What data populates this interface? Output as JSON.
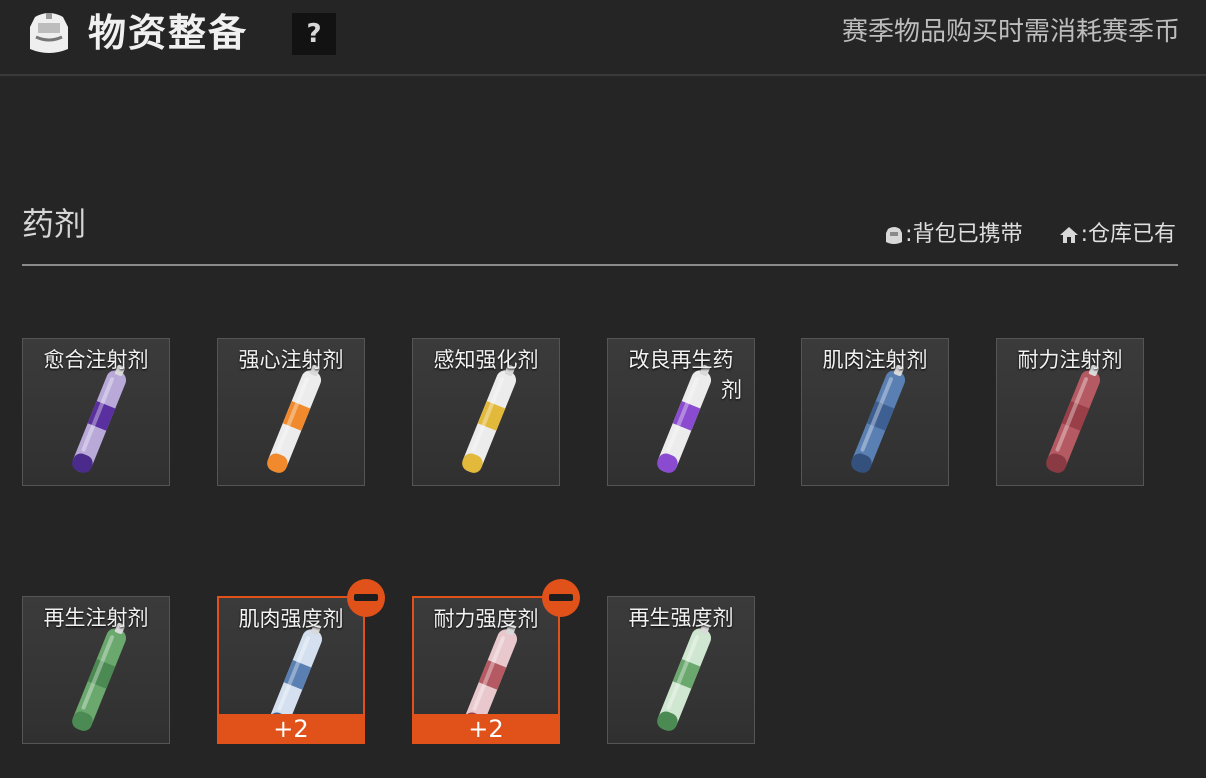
{
  "header": {
    "title": "物资整备",
    "help_label": "?",
    "note": "赛季物品购买时需消耗赛季币"
  },
  "section": {
    "title": "药剂",
    "legend": {
      "backpack": ":背包已携带",
      "warehouse": ":仓库已有"
    }
  },
  "items": [
    {
      "name": "愈合注射剂",
      "line2": "",
      "colors": {
        "body": "#b9a9d9",
        "band": "#5a2fa0",
        "tip": "#4a2a8a"
      },
      "selected": false
    },
    {
      "name": "强心注射剂",
      "line2": "",
      "colors": {
        "body": "#ececec",
        "band": "#f08a2c",
        "tip": "#f08a2c"
      },
      "selected": false
    },
    {
      "name": "感知强化剂",
      "line2": "",
      "colors": {
        "body": "#ececec",
        "band": "#e2b93a",
        "tip": "#e2b93a"
      },
      "selected": false
    },
    {
      "name": "改良再生药",
      "line2": "剂",
      "colors": {
        "body": "#ececec",
        "band": "#8a4bd0",
        "tip": "#8a4bd0"
      },
      "selected": false
    },
    {
      "name": "肌肉注射剂",
      "line2": "",
      "colors": {
        "body": "#5a7fb3",
        "band": "#3e5f92",
        "tip": "#34507c"
      },
      "selected": false
    },
    {
      "name": "耐力注射剂",
      "line2": "",
      "colors": {
        "body": "#b55a62",
        "band": "#9a3f48",
        "tip": "#8a3a42"
      },
      "selected": false
    },
    {
      "name": "再生注射剂",
      "line2": "",
      "colors": {
        "body": "#6aa86e",
        "band": "#4b8a52",
        "tip": "#4b8a52"
      },
      "selected": false
    },
    {
      "name": "肌肉强度剂",
      "line2": "",
      "colors": {
        "body": "#d4e0f0",
        "band": "#5a7fb3",
        "tip": "#3e5f92"
      },
      "selected": true,
      "quantity": "+2"
    },
    {
      "name": "耐力强度剂",
      "line2": "",
      "colors": {
        "body": "#e8c8cc",
        "band": "#b55a62",
        "tip": "#9a3f48"
      },
      "selected": true,
      "quantity": "+2"
    },
    {
      "name": "再生强度剂",
      "line2": "",
      "colors": {
        "body": "#cfe6d0",
        "band": "#6aa86e",
        "tip": "#4b8a52"
      },
      "selected": false
    }
  ],
  "accent_color": "#e0521a"
}
